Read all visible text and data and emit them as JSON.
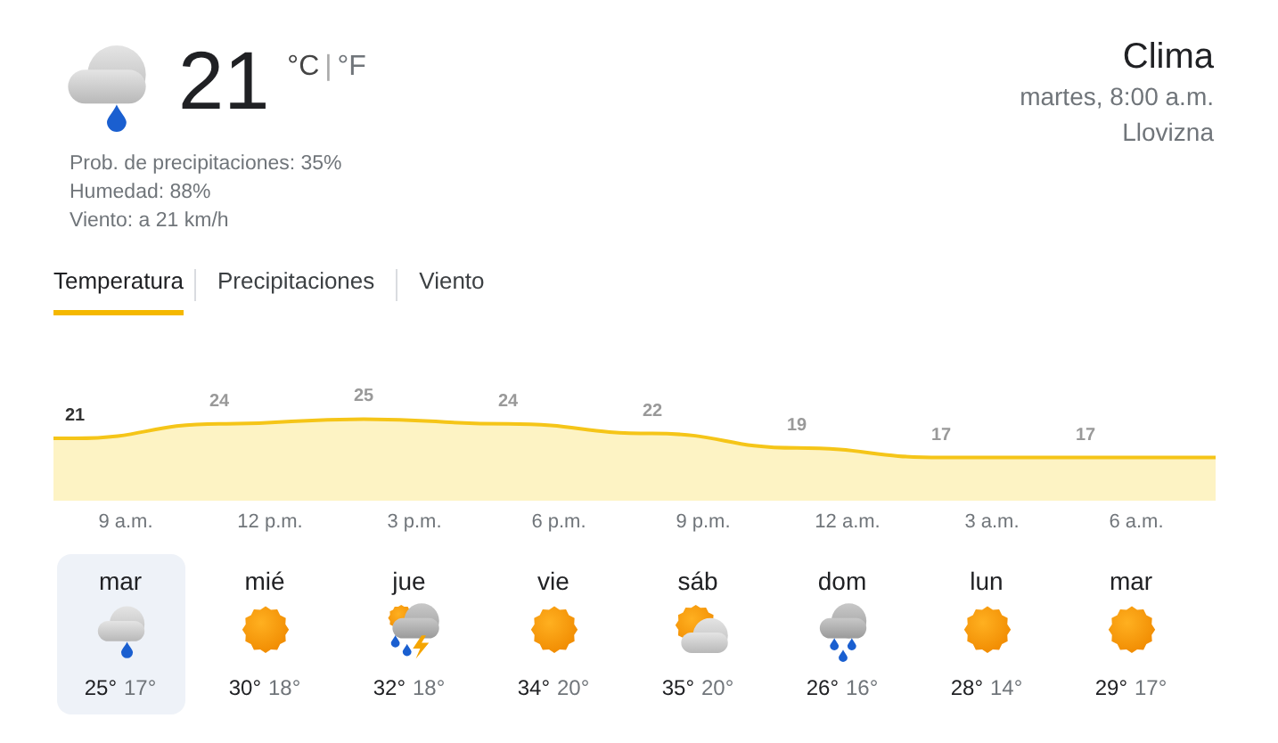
{
  "current": {
    "temperature": "21",
    "unit_celsius": "°C",
    "unit_separator": "|",
    "unit_fahrenheit": "°F",
    "kind": "rain",
    "details": [
      "Prob. de precipitaciones: 35%",
      "Humedad: 88%",
      "Viento: a 21 km/h"
    ]
  },
  "header": {
    "title": "Clima",
    "datetime": "martes, 8:00 a.m.",
    "condition": "Llovizna"
  },
  "tabs": [
    {
      "label": "Temperatura",
      "selected": true
    },
    {
      "label": "Precipitaciones",
      "selected": false
    },
    {
      "label": "Viento",
      "selected": false
    }
  ],
  "hourly": [
    {
      "time": "9 a.m.",
      "temperature": "21",
      "selected": true
    },
    {
      "time": "12 p.m.",
      "temperature": "24",
      "selected": false
    },
    {
      "time": "3 p.m.",
      "temperature": "25",
      "selected": false
    },
    {
      "time": "6 p.m.",
      "temperature": "24",
      "selected": false
    },
    {
      "time": "9 p.m.",
      "temperature": "22",
      "selected": false
    },
    {
      "time": "12 a.m.",
      "temperature": "19",
      "selected": false
    },
    {
      "time": "3 a.m.",
      "temperature": "17",
      "selected": false
    },
    {
      "time": "6 a.m.",
      "temperature": "17",
      "selected": false
    }
  ],
  "days": [
    {
      "day": "mar",
      "kind": "rain",
      "high": "25°",
      "low": "17°",
      "selected": true
    },
    {
      "day": "mié",
      "kind": "sun",
      "high": "30°",
      "low": "18°",
      "selected": false
    },
    {
      "day": "jue",
      "kind": "storm",
      "high": "32°",
      "low": "18°",
      "selected": false
    },
    {
      "day": "vie",
      "kind": "sun",
      "high": "34°",
      "low": "20°",
      "selected": false
    },
    {
      "day": "sáb",
      "kind": "partly-cloudy",
      "high": "35°",
      "low": "20°",
      "selected": false
    },
    {
      "day": "dom",
      "kind": "showers",
      "high": "26°",
      "low": "16°",
      "selected": false
    },
    {
      "day": "lun",
      "kind": "sun",
      "high": "28°",
      "low": "14°",
      "selected": false
    },
    {
      "day": "mar",
      "kind": "sun",
      "high": "29°",
      "low": "17°",
      "selected": false
    }
  ]
}
